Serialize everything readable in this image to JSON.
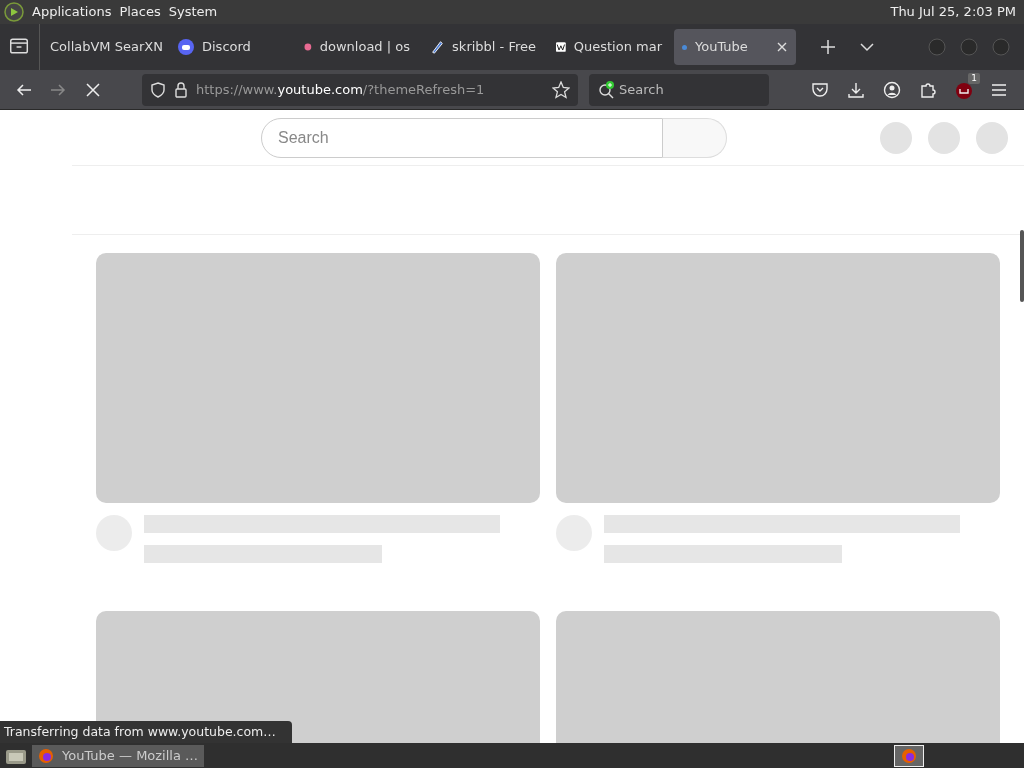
{
  "top_panel": {
    "menus": [
      "Applications",
      "Places",
      "System"
    ],
    "clock": "Thu Jul 25, 2:03 PM"
  },
  "tabs": [
    {
      "label": "CollabVM SearXN",
      "kind": "plain",
      "selected": false
    },
    {
      "label": "Discord",
      "kind": "chat",
      "selected": false
    },
    {
      "label": "download | os",
      "kind": "dot",
      "selected": false
    },
    {
      "label": "skribbl - Free",
      "kind": "pen",
      "selected": false
    },
    {
      "label": "Question mar",
      "kind": "wiki",
      "selected": false
    },
    {
      "label": "YouTube",
      "kind": "loading",
      "selected": true
    }
  ],
  "toolbar": {
    "url": {
      "prefix": "https://www.",
      "domain": "youtube.com",
      "suffix": "/?themeRefresh=1"
    },
    "search": {
      "placeholder": "Search"
    },
    "addon_badge": "1"
  },
  "page": {
    "search": {
      "placeholder": "Search"
    }
  },
  "status": "Transferring data from www.youtube.com…",
  "taskbar": {
    "windows": [
      {
        "label": "YouTube — Mozilla …",
        "selected": true
      }
    ]
  }
}
